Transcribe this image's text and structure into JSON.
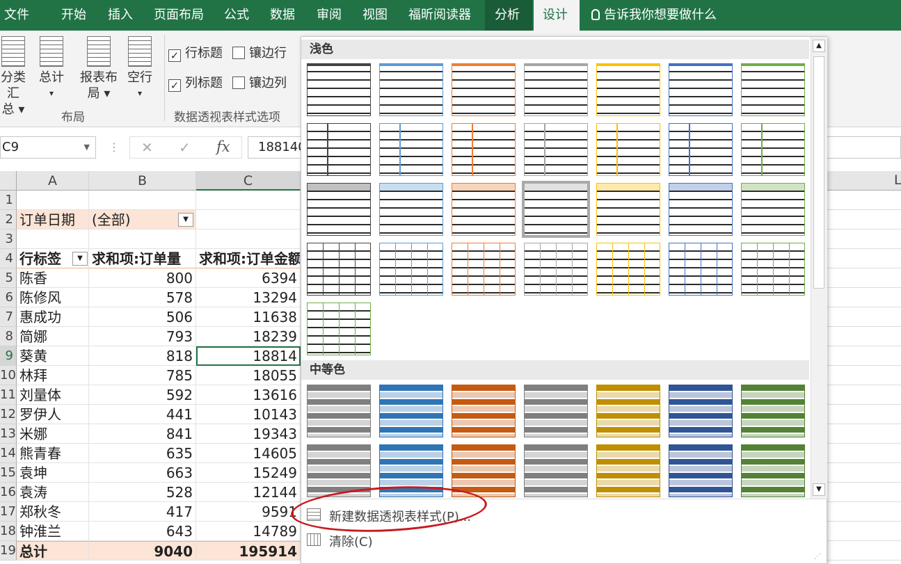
{
  "tabs": [
    "文件",
    "开始",
    "插入",
    "页面布局",
    "公式",
    "数据",
    "审阅",
    "视图",
    "福昕阅读器",
    "分析",
    "设计"
  ],
  "tell_me": "告诉我你想要做什么",
  "ribbon": {
    "subtotal_line1": "分类汇",
    "subtotal_line2": "总",
    "grandtotal": "总计",
    "report_line1": "报表布",
    "report_line2": "局",
    "blank_rows": "空行",
    "layout_group": "布局",
    "row_headers": "行标题",
    "banded_rows": "镶边行",
    "col_headers": "列标题",
    "banded_cols": "镶边列",
    "options_group": "数据透视表样式选项"
  },
  "formula_bar": {
    "name_box": "C9",
    "fx": "fx",
    "value": "188140"
  },
  "columns": [
    "A",
    "B",
    "C"
  ],
  "right_col": "L",
  "rows": [
    {
      "n": "1",
      "a": "",
      "b": "",
      "c": ""
    },
    {
      "n": "2",
      "a": "订单日期",
      "b": "(全部)",
      "c": ""
    },
    {
      "n": "3",
      "a": "",
      "b": "",
      "c": ""
    },
    {
      "n": "4",
      "a": "行标签",
      "b": "求和项:订单量",
      "c": "求和项:订单金额"
    },
    {
      "n": "5",
      "a": "陈香",
      "b": "800",
      "c": "6394"
    },
    {
      "n": "6",
      "a": "陈修风",
      "b": "578",
      "c": "13294"
    },
    {
      "n": "7",
      "a": "惠成功",
      "b": "506",
      "c": "11638"
    },
    {
      "n": "8",
      "a": "简娜",
      "b": "793",
      "c": "18239"
    },
    {
      "n": "9",
      "a": "葵黄",
      "b": "818",
      "c": "18814"
    },
    {
      "n": "10",
      "a": "林拜",
      "b": "785",
      "c": "18055"
    },
    {
      "n": "11",
      "a": "刘量体",
      "b": "592",
      "c": "13616"
    },
    {
      "n": "12",
      "a": "罗伊人",
      "b": "441",
      "c": "10143"
    },
    {
      "n": "13",
      "a": "米娜",
      "b": "841",
      "c": "19343"
    },
    {
      "n": "14",
      "a": "熊青春",
      "b": "635",
      "c": "14605"
    },
    {
      "n": "15",
      "a": "袁坤",
      "b": "663",
      "c": "15249"
    },
    {
      "n": "16",
      "a": "袁涛",
      "b": "528",
      "c": "12144"
    },
    {
      "n": "17",
      "a": "郑秋冬",
      "b": "417",
      "c": "9591"
    },
    {
      "n": "18",
      "a": "钟淮兰",
      "b": "643",
      "c": "14789"
    },
    {
      "n": "19",
      "a": "总计",
      "b": "9040",
      "c": "195914"
    }
  ],
  "gallery": {
    "light_label": "浅色",
    "medium_label": "中等色",
    "new_style": "新建数据透视表样式(P)...",
    "clear": "清除(C)",
    "light_colors": [
      "#444444",
      "#5b9bd5",
      "#ed7d31",
      "#a5a5a5",
      "#ffc000",
      "#4472c4",
      "#70ad47"
    ],
    "medium_colors": [
      "#7f7f7f",
      "#2e75b6",
      "#c55a11",
      "#7f7f7f",
      "#bf8f00",
      "#2f5597",
      "#548235"
    ]
  },
  "colors": {
    "accent": "#217346",
    "pivot_header": "#fce4d6"
  }
}
